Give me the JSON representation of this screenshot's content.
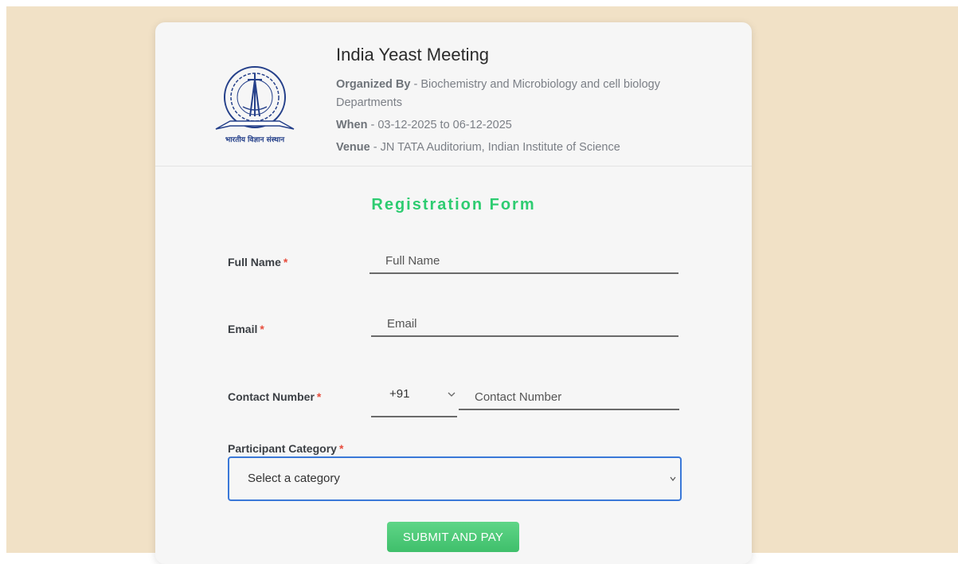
{
  "colors": {
    "page_background": "#f1e1c6",
    "card_background": "#f6f6f6",
    "accent_green": "#2ecc71",
    "required_red": "#e74c3c",
    "focus_blue": "#3a78d8"
  },
  "header": {
    "logo_icon": "iisc-emblem-icon",
    "logo_caption": "भारतीय विज्ञान संस्थान",
    "title": "India Yeast Meeting",
    "organized_by_label": "Organized By",
    "organized_by_value": " - Biochemistry and Microbiology and cell biology Departments",
    "when_label": "When",
    "when_value": " - 03-12-2025 to 06-12-2025",
    "venue_label": "Venue",
    "venue_value": " - JN TATA Auditorium, Indian Institute of Science"
  },
  "form": {
    "title": "Registration Form",
    "required_marker": "*",
    "full_name": {
      "label": "Full Name",
      "placeholder": "Full Name",
      "value": ""
    },
    "email": {
      "label": "Email",
      "placeholder": "Email",
      "value": ""
    },
    "contact": {
      "label": "Contact Number",
      "country_code": "+91",
      "placeholder": "Contact Number",
      "value": ""
    },
    "category": {
      "label": "Participant Category",
      "selected": "Select a category"
    },
    "submit_label": "SUBMIT AND PAY"
  }
}
